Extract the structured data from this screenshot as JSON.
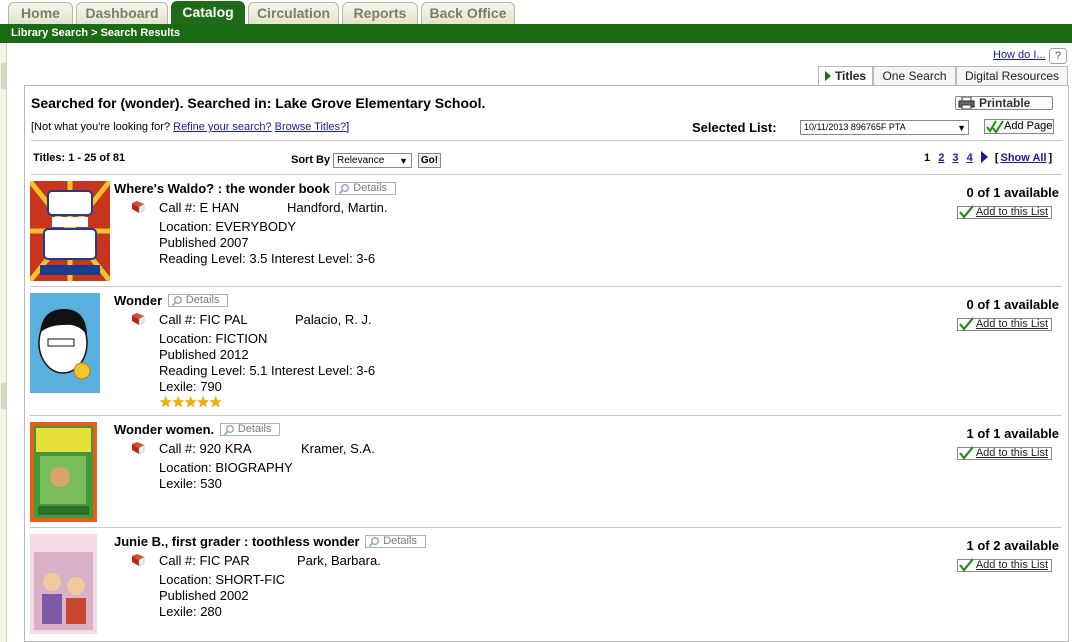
{
  "tabs": [
    {
      "label": "Home",
      "active": false
    },
    {
      "label": "Dashboard",
      "active": false
    },
    {
      "label": "Catalog",
      "active": true
    },
    {
      "label": "Circulation",
      "active": false
    },
    {
      "label": "Reports",
      "active": false
    },
    {
      "label": "Back Office",
      "active": false
    }
  ],
  "breadcrumb": "Library Search > Search Results",
  "help": {
    "how_do_i": "How do I...",
    "help_glyph": "?"
  },
  "content_tabs": [
    {
      "label": "Titles",
      "active": true
    },
    {
      "label": "One Search",
      "active": false
    },
    {
      "label": "Digital Resources",
      "active": false
    }
  ],
  "search_summary": "Searched for (wonder). Searched in: Lake Grove Elementary School.",
  "printable_label": "Printable",
  "not_what": {
    "prefix": "[Not what you're looking for? ",
    "refine": "Refine your search?",
    "browse": "Browse Titles?",
    "suffix": "]"
  },
  "selected_list": {
    "label": "Selected List:",
    "value": "10/11/2013 896765F PTA",
    "add_page": "Add Page"
  },
  "results_header": {
    "count": "Titles: 1 - 25 of 81",
    "sort_label": "Sort By",
    "sort_value": "Relevance",
    "go_label": "Go!",
    "pages": [
      "1",
      "2",
      "3",
      "4"
    ],
    "current_page": "1",
    "show_all": "Show All",
    "bracket_open": "[",
    "bracket_close": "]"
  },
  "results": [
    {
      "title": "Where's Waldo? : the wonder book",
      "details": "Details",
      "call": "Call #: E HAN",
      "author": "Handford, Martin.",
      "location": "Location: EVERYBODY",
      "published": "Published 2007",
      "levels": "Reading Level: 3.5  Interest Level: 3-6",
      "availability": "0 of 1 available",
      "add_list": "Add to this List"
    },
    {
      "title": "Wonder",
      "details": "Details",
      "call": "Call #: FIC PAL",
      "author": "Palacio, R. J.",
      "location": "Location: FICTION",
      "published": "Published 2012",
      "levels": "Reading Level: 5.1  Interest Level: 3-6",
      "lexile": "Lexile: 790",
      "rating": 5,
      "availability": "0 of 1 available",
      "add_list": "Add to this List"
    },
    {
      "title": "Wonder women.",
      "details": "Details",
      "call": "Call #: 920 KRA",
      "author": "Kramer, S.A.",
      "location": "Location: BIOGRAPHY",
      "lexile": "Lexile: 530",
      "availability": "1 of 1 available",
      "add_list": "Add to this List"
    },
    {
      "title": "Junie B., first grader : toothless wonder",
      "details": "Details",
      "call": "Call #: FIC PAR",
      "author": "Park, Barbara.",
      "location": "Location: SHORT-FIC",
      "published": "Published 2002",
      "lexile": "Lexile: 280",
      "availability": "1 of 2 available",
      "add_list": "Add to this List"
    }
  ],
  "colors": {
    "brand_green": "#1b6b15",
    "link_blue": "#1a1aa6",
    "star_gold": "#f0b200"
  }
}
